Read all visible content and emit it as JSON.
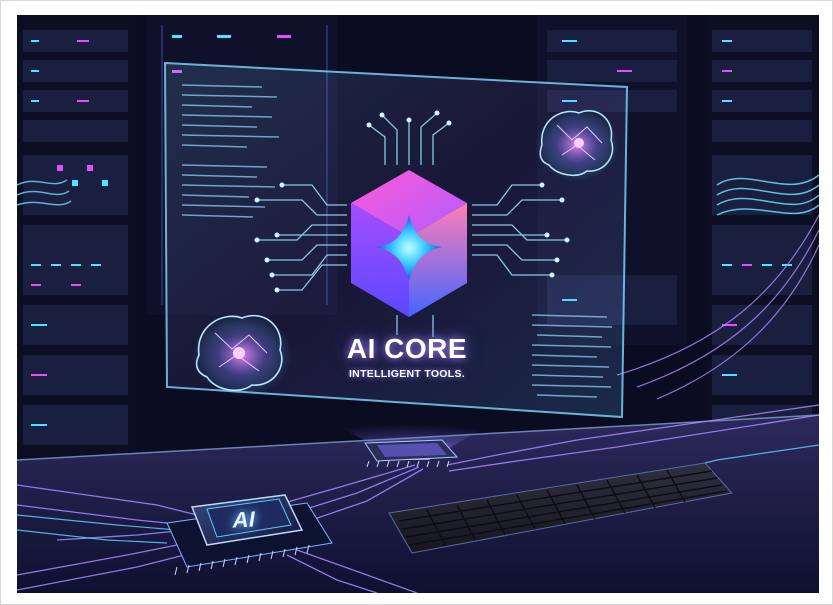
{
  "scene": {
    "description_tags": [
      "server-racks",
      "holographic-display",
      "brain-hologram",
      "processor-chip",
      "keyboard",
      "circuit-traces"
    ],
    "colors": {
      "background_dark": "#07091a",
      "accent_cyan": "#4fe3ff",
      "accent_magenta": "#e34fff",
      "accent_purple": "#7b5cff",
      "logo_pink": "#e85cd6",
      "logo_blue": "#3d6bff"
    }
  },
  "hologram": {
    "title": "AI CORE",
    "subtitle": "INTELLIGENT TOOLS."
  },
  "chip": {
    "label": "AI"
  }
}
